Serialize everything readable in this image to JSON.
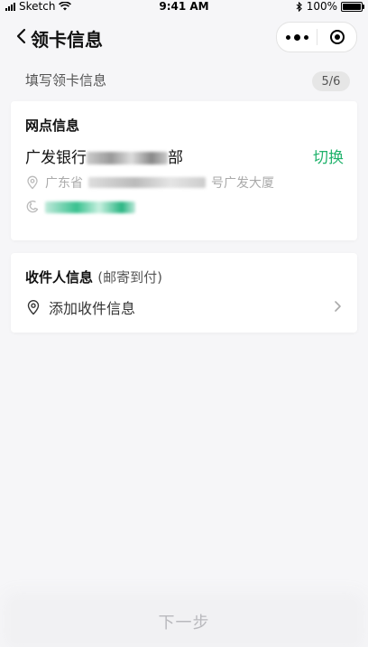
{
  "status_bar": {
    "carrier": "Sketch",
    "time": "9:41 AM",
    "battery": "100%"
  },
  "nav": {
    "title": "领卡信息"
  },
  "section": {
    "title": "填写领卡信息",
    "step": "5/6"
  },
  "branch_card": {
    "title": "网点信息",
    "name_prefix": "广发银行",
    "name_suffix": "部",
    "switch_label": "切换",
    "address_prefix": "广东省",
    "address_suffix": "号广发大厦"
  },
  "recipient_card": {
    "title": "收件人信息",
    "title_note": "(邮寄到付)",
    "add_label": "添加收件信息"
  },
  "footer": {
    "next_label": "下一步"
  },
  "colors": {
    "accent": "#1fb26b",
    "background": "#f6f6f8",
    "disabled_text": "#b9b9bd"
  }
}
